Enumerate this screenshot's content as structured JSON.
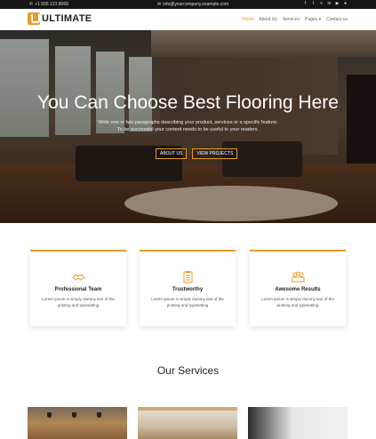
{
  "topbar": {
    "phone": "+1 555 123 8069",
    "email": "info@yourcompany.example.com",
    "social_icons": [
      "facebook-icon",
      "twitter-icon",
      "vimeo-icon",
      "linkedin-icon",
      "youtube-icon",
      "github-icon"
    ]
  },
  "header": {
    "logo_text": "ULTIMATE",
    "nav": [
      "Home",
      "About Us",
      "Services",
      "Pages",
      "Contact us"
    ]
  },
  "hero": {
    "title": "You Can Choose Best Flooring Here",
    "subtitle_line1": "Write one or two paragraphs describing your product, services or a specific feature.",
    "subtitle_line2": "To be successful your content needs to be useful to your readers.",
    "button_about": "ABOUT US",
    "button_projects": "VIEW PROJECTS"
  },
  "features": [
    {
      "title": "Professional Team",
      "icon": "handshake-icon",
      "text": "Lorem Ipsum is simply dummy text of the printing and typesetting"
    },
    {
      "title": "Trustworthy",
      "icon": "clipboard-icon",
      "text": "Lorem Ipsum is simply dummy text of the printing and typesetting"
    },
    {
      "title": "Awesome Results",
      "icon": "results-icon",
      "text": "Lorem Ipsum is simply dummy text of the printing and typesetting"
    }
  ],
  "services": {
    "title": "Our Services"
  },
  "colors": {
    "accent": "#e79b2a",
    "topbar": "#151515"
  }
}
